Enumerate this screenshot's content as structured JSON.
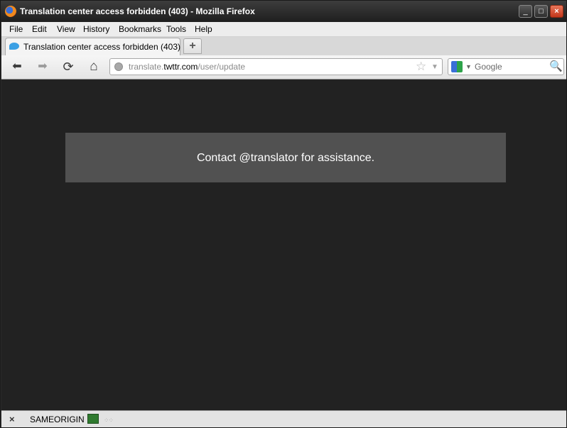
{
  "window": {
    "title": "Translation center access forbidden (403) - Mozilla Firefox",
    "minimize_icon": "minimize-icon",
    "maximize_icon": "maximize-icon",
    "close_icon": "close-icon"
  },
  "menu": {
    "items": [
      {
        "label": "File"
      },
      {
        "label": "Edit"
      },
      {
        "label": "View"
      },
      {
        "label": "History"
      },
      {
        "label": "Bookmarks"
      },
      {
        "label": "Tools"
      },
      {
        "label": "Help"
      }
    ]
  },
  "tabs": {
    "active_label": "Translation center access forbidden (403)",
    "new_tab_glyph": "+"
  },
  "navbar": {
    "back_glyph": "⬅",
    "forward_glyph": "➡",
    "reload_glyph": "⟳",
    "home_glyph": "⌂",
    "url_prefix": "translate.",
    "url_domain": "twttr.com",
    "url_path": "/user/update",
    "star_glyph": "☆",
    "dropdown_glyph": "▼"
  },
  "search": {
    "engine": "Google",
    "drop_glyph": "▼",
    "mag_glyph": "🔍"
  },
  "page": {
    "message": "Contact @translator for assistance.",
    "background": "#222222",
    "box_color": "#515151"
  },
  "statusbar": {
    "close_glyph": "×",
    "text": "SAMEORIGIN",
    "grip_glyph": "⁘⁘"
  }
}
